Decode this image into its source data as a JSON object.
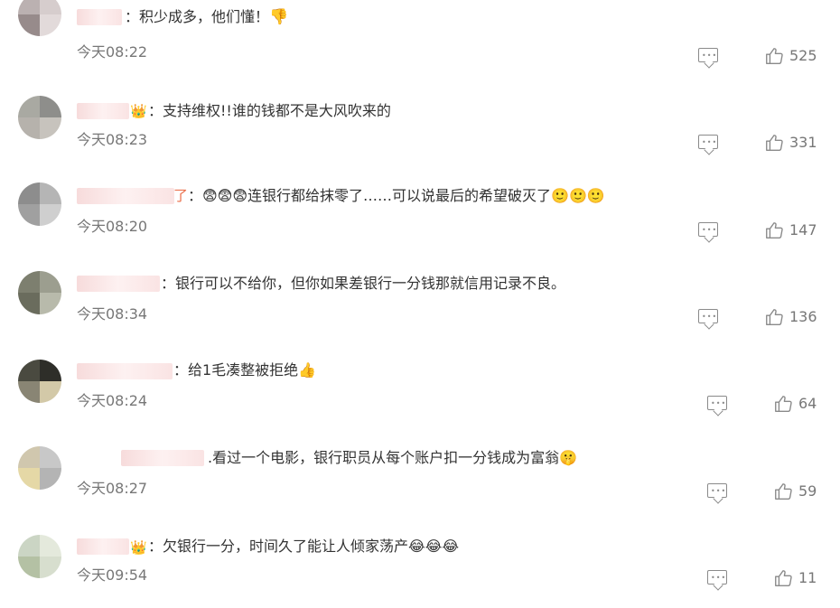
{
  "comments": [
    {
      "text": "：积少成多，他们懂！",
      "emoji": "👎",
      "time": "今天08:22",
      "likes": "525",
      "avatar_colors": [
        "#bdb0b0",
        "#d8cdcd",
        "#9a8a8a",
        "#e4dada"
      ]
    },
    {
      "text": "：支持维权!!谁的钱都不是大风吹来的",
      "badge": "👑",
      "time": "今天08:23",
      "likes": "331",
      "avatar_colors": [
        "#a9a9a0",
        "#8e8e8a",
        "#b7b2aa",
        "#c8c3bb"
      ]
    },
    {
      "text": "：😨😨😨连银行都给抹零了……可以说最后的希望破灭了🙂🙂🙂",
      "name_tail": "了",
      "time": "今天08:20",
      "likes": "147",
      "avatar_colors": [
        "#8d8d8d",
        "#b5b5b5",
        "#a0a0a0",
        "#cfcfcf"
      ]
    },
    {
      "text": "：银行可以不给你，但你如果差银行一分钱那就信用记录不良。",
      "time": "今天08:34",
      "likes": "136",
      "avatar_colors": [
        "#7d7f6c",
        "#9c9e8c",
        "#6a6c5a",
        "#b8baa8"
      ]
    },
    {
      "text": "：给1毛凑整被拒绝👍",
      "time": "今天08:24",
      "likes": "64",
      "avatar_colors": [
        "#4a4a3e",
        "#2e2e28",
        "#8a8570",
        "#d6c9a0"
      ]
    },
    {
      "text": ".看过一个电影，银行职员从每个账户扣一分钱成为富翁🤫",
      "time": "今天08:27",
      "likes": "59",
      "avatar_colors": [
        "#d2c7a8",
        "#c8c8c8",
        "#e8d89a",
        "#b4b4b4"
      ]
    },
    {
      "text": "：欠银行一分，时间久了能让人倾家荡产😂😂😂",
      "badge": "👑",
      "time": "今天09:54",
      "likes": "11",
      "avatar_colors": [
        "#c9d6c0",
        "#e3ead9",
        "#b2c29e",
        "#d6dfcb"
      ]
    }
  ]
}
